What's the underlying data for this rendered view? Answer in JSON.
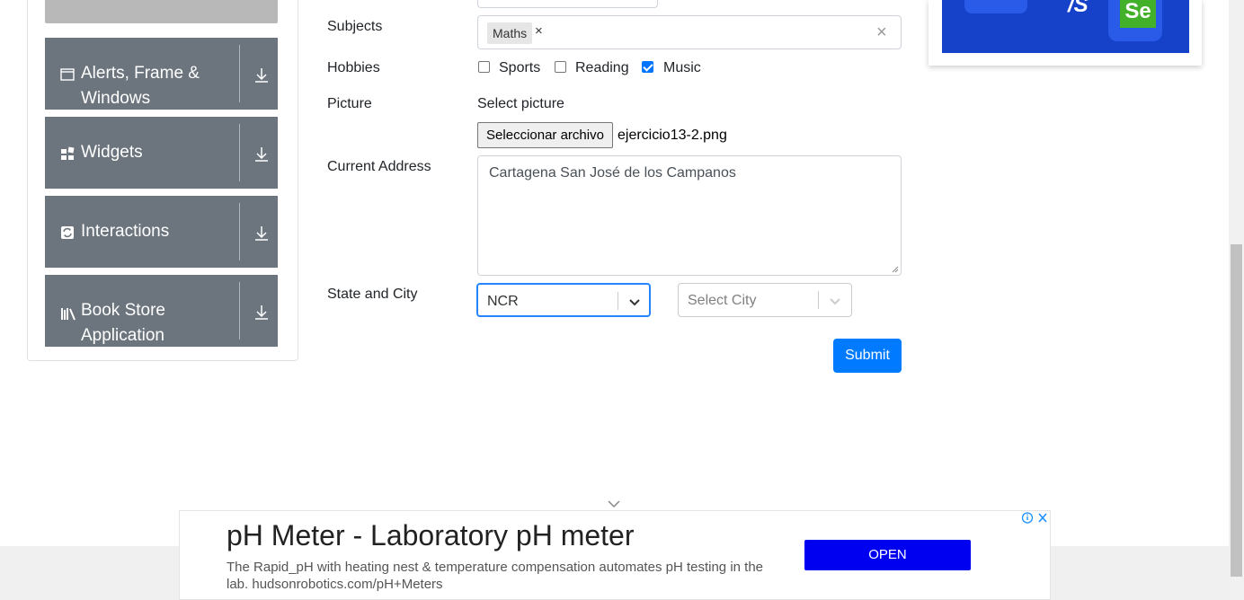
{
  "sidebar": {
    "groups": [
      {
        "label": "Alerts, Frame & Windows",
        "icon": "window-icon"
      },
      {
        "label": "Widgets",
        "icon": "widgets-icon"
      },
      {
        "label": "Interactions",
        "icon": "interactions-icon"
      },
      {
        "label": "Book Store Application",
        "icon": "books-icon"
      }
    ]
  },
  "form": {
    "subjects_label": "Subjects",
    "subject_chip": "Maths",
    "chip_remove": "×",
    "clear": "×",
    "hobbies_label": "Hobbies",
    "hobbies": [
      {
        "label": "Sports",
        "checked": false
      },
      {
        "label": "Reading",
        "checked": false
      },
      {
        "label": "Music",
        "checked": true
      }
    ],
    "picture_label": "Picture",
    "select_picture": "Select picture",
    "file_button": "Seleccionar archivo",
    "file_name": "ejercicio13-2.png",
    "address_label": "Current Address",
    "address_value": "Cartagena San José de los Campanos",
    "state_city_label": "State and City",
    "state_value": "NCR",
    "city_placeholder": "Select City",
    "submit": "Submit"
  },
  "ad_top": {
    "text": "/S",
    "badge": "Se"
  },
  "ad_bottom": {
    "title": "pH Meter - Laboratory pH meter",
    "description": "The Rapid_pH with heating nest & temperature compensation automates pH testing in the lab. hudsonrobotics.com/pH+Meters",
    "button": "OPEN"
  },
  "colors": {
    "primary": "#007bff",
    "sidebar_group": "#6c757d",
    "ad_button": "#0000f0"
  }
}
